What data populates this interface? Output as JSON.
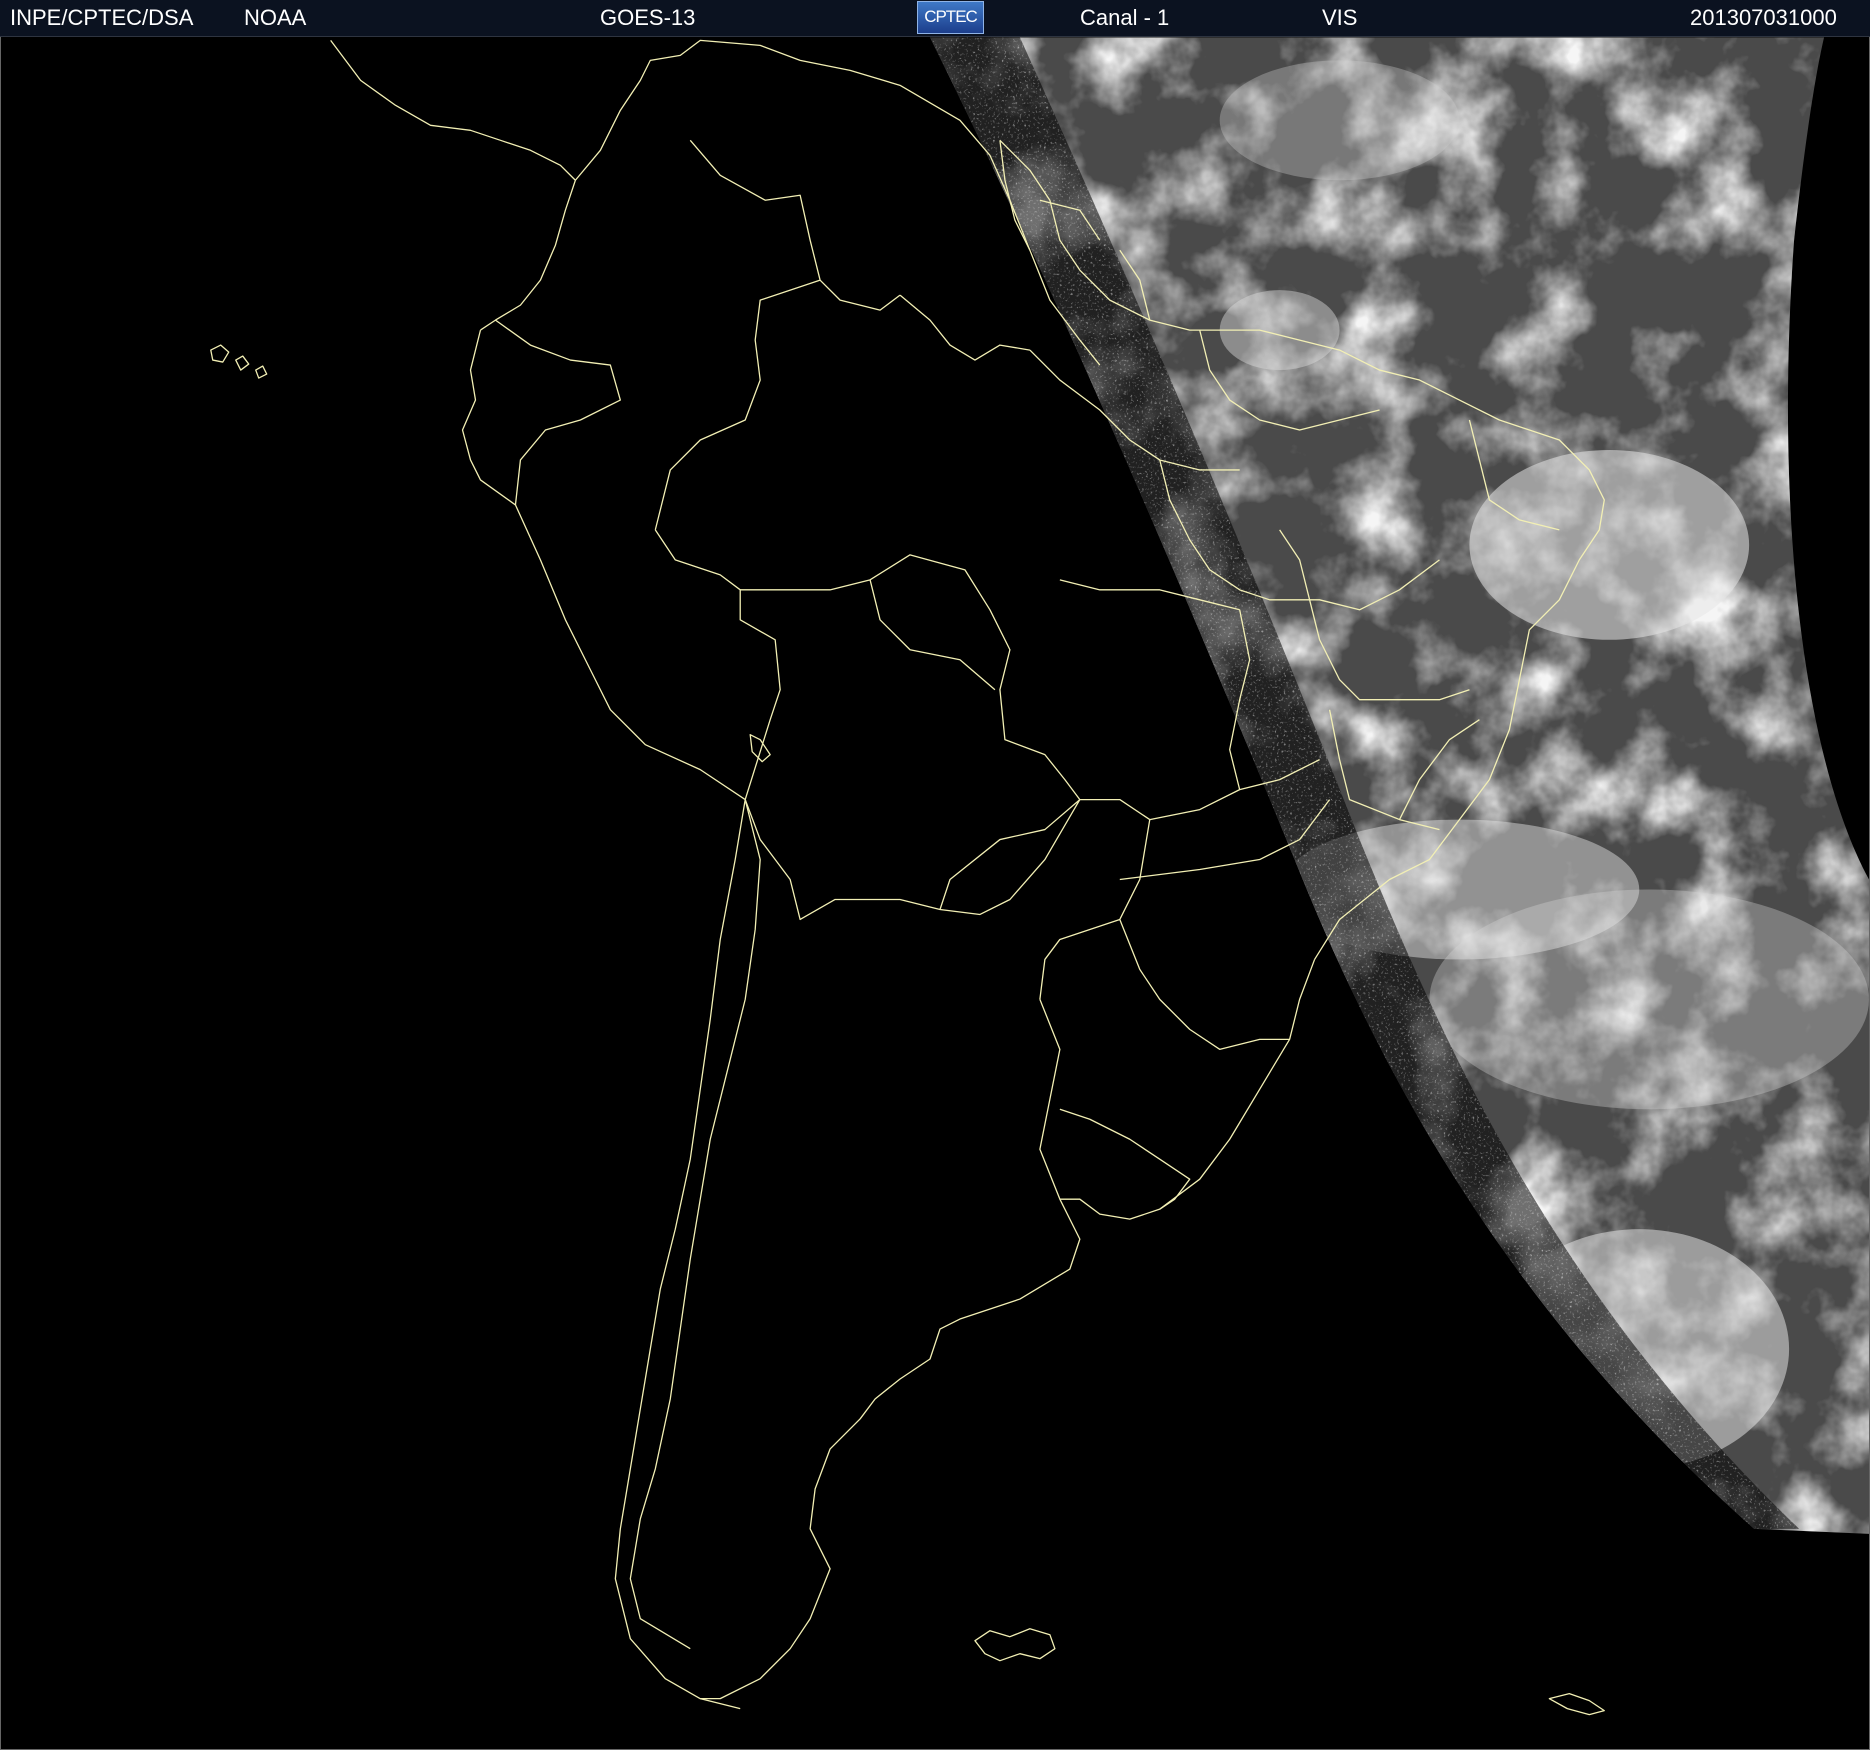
{
  "header": {
    "institution": "INPE/CPTEC/DSA",
    "agency": "NOAA",
    "satellite": "GOES-13",
    "logo_text": "CPTEC",
    "channel": "Canal - 1",
    "band": "VIS",
    "timestamp": "201307031000"
  },
  "map": {
    "region": "South America",
    "imagery": "visible satellite imagery, day side on the east",
    "boundary_color": "#f2efb4",
    "background_color": "#000000",
    "cloud_color": "#dcdcdc",
    "surface_color": "#585858"
  },
  "colors": {
    "header_bg": "#0b1220",
    "header_text": "#ffffff",
    "logo_bg": "#2d5aa8"
  }
}
